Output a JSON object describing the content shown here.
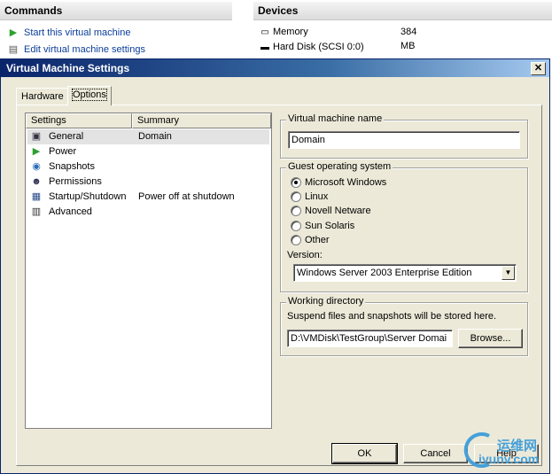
{
  "commands": {
    "title": "Commands",
    "items": [
      {
        "label": "Start this virtual machine",
        "icon": "play-icon"
      },
      {
        "label": "Edit virtual machine settings",
        "icon": "settings-icon"
      }
    ]
  },
  "devices": {
    "title": "Devices",
    "items": [
      {
        "label": "Memory",
        "value": "384 MB",
        "icon": "memory-icon"
      },
      {
        "label": "Hard Disk (SCSI 0:0)",
        "value": "",
        "icon": "hard-disk-icon"
      }
    ]
  },
  "dialog": {
    "title": "Virtual Machine Settings",
    "close": "✕",
    "tabs": [
      {
        "label": "Hardware",
        "active": false
      },
      {
        "label": "Options",
        "active": true
      }
    ],
    "list": {
      "col_settings": "Settings",
      "col_summary": "Summary",
      "rows": [
        {
          "name": "General",
          "summary": "Domain",
          "icon": "general-icon",
          "selected": true
        },
        {
          "name": "Power",
          "summary": "",
          "icon": "power-icon"
        },
        {
          "name": "Snapshots",
          "summary": "",
          "icon": "snapshots-icon"
        },
        {
          "name": "Permissions",
          "summary": "",
          "icon": "permissions-icon"
        },
        {
          "name": "Startup/Shutdown",
          "summary": "Power off at shutdown",
          "icon": "startup-icon"
        },
        {
          "name": "Advanced",
          "summary": "",
          "icon": "advanced-icon"
        }
      ]
    },
    "vm_name": {
      "legend": "Virtual machine name",
      "value": "Domain"
    },
    "guest_os": {
      "legend": "Guest operating system",
      "options": [
        {
          "label": "Microsoft Windows",
          "checked": true
        },
        {
          "label": "Linux",
          "checked": false
        },
        {
          "label": "Novell Netware",
          "checked": false
        },
        {
          "label": "Sun Solaris",
          "checked": false
        },
        {
          "label": "Other",
          "checked": false
        }
      ],
      "version_label": "Version:",
      "version_value": "Windows Server 2003 Enterprise Edition"
    },
    "working_dir": {
      "legend": "Working directory",
      "description": "Suspend files and snapshots will be stored here.",
      "path": "D:\\VMDisk\\TestGroup\\Server Domai",
      "browse": "Browse..."
    },
    "buttons": {
      "ok": "OK",
      "cancel": "Cancel",
      "help": "Help"
    }
  },
  "watermark": {
    "text_cn": "运维网",
    "text_url": "iyunv.com"
  }
}
